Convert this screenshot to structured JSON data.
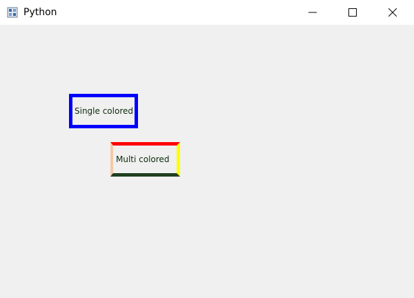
{
  "window": {
    "title": "Python",
    "icon": "python-app-icon"
  },
  "controls": {
    "minimize_icon": "minimize-icon",
    "maximize_icon": "maximize-icon",
    "close_icon": "close-icon"
  },
  "labels": {
    "single": {
      "text": "Single colored",
      "border_color": "#0000ff"
    },
    "multi": {
      "text": "Multi colored",
      "border_top": "#ff0000",
      "border_right": "#ffff00",
      "border_bottom": "#1f3f1f",
      "border_left": "#f5c9a8"
    }
  }
}
